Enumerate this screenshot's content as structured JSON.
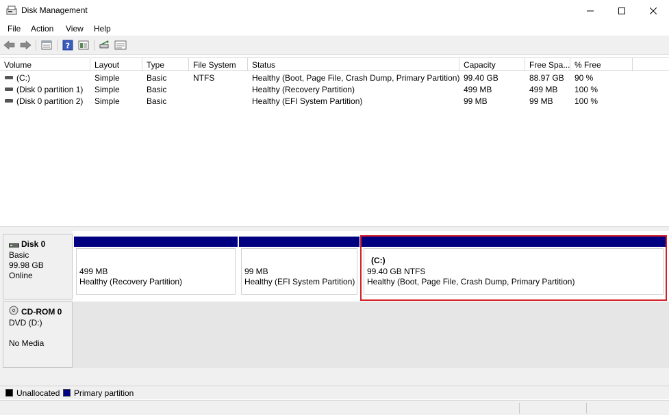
{
  "window": {
    "title": "Disk Management"
  },
  "menu": [
    "File",
    "Action",
    "View",
    "Help"
  ],
  "toolbar": [
    "back-arrow-icon",
    "forward-arrow-icon",
    "properties-icon",
    "help-icon",
    "disk-view-icon",
    "connect-icon",
    "list-view-icon"
  ],
  "volume_list": {
    "columns": [
      "Volume",
      "Layout",
      "Type",
      "File System",
      "Status",
      "Capacity",
      "Free Spa...",
      "% Free"
    ],
    "rows": [
      {
        "volume": "(C:)",
        "layout": "Simple",
        "type": "Basic",
        "fs": "NTFS",
        "status": "Healthy (Boot, Page File, Crash Dump, Primary Partition)",
        "capacity": "99.40 GB",
        "free": "88.97 GB",
        "pct": "90 %"
      },
      {
        "volume": "(Disk 0 partition 1)",
        "layout": "Simple",
        "type": "Basic",
        "fs": "",
        "status": "Healthy (Recovery Partition)",
        "capacity": "499 MB",
        "free": "499 MB",
        "pct": "100 %"
      },
      {
        "volume": "(Disk 0 partition 2)",
        "layout": "Simple",
        "type": "Basic",
        "fs": "",
        "status": "Healthy (EFI System Partition)",
        "capacity": "99 MB",
        "free": "99 MB",
        "pct": "100 %"
      }
    ]
  },
  "disks": [
    {
      "name": "Disk 0",
      "type": "Basic",
      "size": "99.98 GB",
      "state": "Online",
      "partitions": [
        {
          "title": "",
          "size": "499 MB",
          "status": "Healthy (Recovery Partition)"
        },
        {
          "title": "",
          "size": "99 MB",
          "status": "Healthy (EFI System Partition)"
        },
        {
          "title": "(C:)",
          "size": "99.40 GB NTFS",
          "status": "Healthy (Boot, Page File, Crash Dump, Primary Partition)"
        }
      ]
    },
    {
      "name": "CD-ROM 0",
      "type": "DVD (D:)",
      "size": "",
      "state": "No Media",
      "partitions": []
    }
  ],
  "legend": [
    {
      "label": "Unallocated",
      "color": "#000000"
    },
    {
      "label": "Primary partition",
      "color": "#000080"
    }
  ],
  "colors": {
    "primary_bar": "#000080",
    "highlight": "#d32027"
  }
}
